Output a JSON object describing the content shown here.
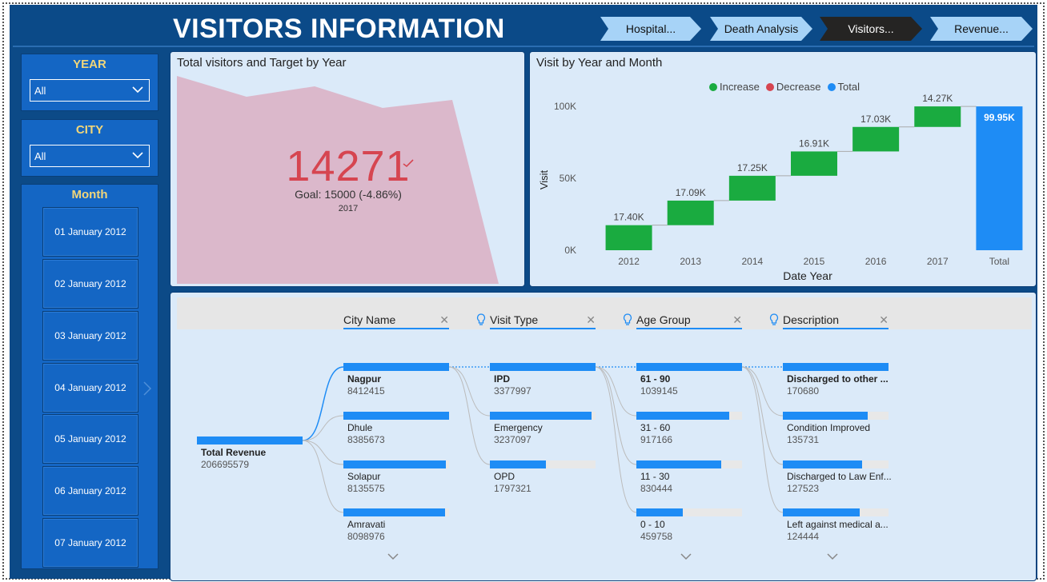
{
  "header": {
    "title": "VISITORS INFORMATION",
    "nav": [
      {
        "label": "Hospital...",
        "active": false
      },
      {
        "label": "Death Analysis",
        "active": false
      },
      {
        "label": "Visitors...",
        "active": true
      },
      {
        "label": "Revenue...",
        "active": false
      }
    ]
  },
  "sidebar": {
    "year": {
      "title": "YEAR",
      "value": "All"
    },
    "city": {
      "title": "CITY",
      "value": "All"
    },
    "month": {
      "title": "Month",
      "items": [
        "01 January 2012",
        "02 January 2012",
        "03 January 2012",
        "04 January 2012",
        "05 January 2012",
        "06 January 2012",
        "07 January 2012"
      ]
    }
  },
  "kpi": {
    "title": "Total visitors and Target by Year",
    "value": "14271",
    "goal": "Goal: 15000 (-4.86%)",
    "year": "2017"
  },
  "waterfall": {
    "title": "Visit by Year and Month",
    "legend": [
      {
        "label": "Increase",
        "color": "#1aab40"
      },
      {
        "label": "Decrease",
        "color": "#d64550"
      },
      {
        "label": "Total",
        "color": "#1e8cf5"
      }
    ]
  },
  "chart_data": {
    "type": "bar",
    "subtype": "waterfall",
    "categories": [
      "2012",
      "2013",
      "2014",
      "2015",
      "2016",
      "2017",
      "Total"
    ],
    "values": [
      17.4,
      17.09,
      17.25,
      16.91,
      17.03,
      14.27,
      99.95
    ],
    "data_labels": [
      "17.40K",
      "17.09K",
      "17.25K",
      "16.91K",
      "17.03K",
      "14.27K",
      "99.95K"
    ],
    "xlabel": "Date Year",
    "ylabel": "Visit",
    "yticks": [
      "0K",
      "50K",
      "100K"
    ],
    "ylim": [
      0,
      100
    ],
    "unit": "K"
  },
  "tree": {
    "columns": [
      "City Name",
      "Visit Type",
      "Age Group",
      "Description"
    ],
    "root": {
      "label": "Total Revenue",
      "value": "206695579"
    },
    "city": [
      {
        "label": "Nagpur",
        "value": "8412415",
        "fill": 1.0
      },
      {
        "label": "Dhule",
        "value": "8385673",
        "fill": 1.0
      },
      {
        "label": "Solapur",
        "value": "8135575",
        "fill": 0.97
      },
      {
        "label": "Amravati",
        "value": "8098976",
        "fill": 0.96
      }
    ],
    "visit_type": [
      {
        "label": "IPD",
        "value": "3377997",
        "fill": 1.0
      },
      {
        "label": "Emergency",
        "value": "3237097",
        "fill": 0.96
      },
      {
        "label": "OPD",
        "value": "1797321",
        "fill": 0.53
      }
    ],
    "age_group": [
      {
        "label": "61 - 90",
        "value": "1039145",
        "fill": 1.0
      },
      {
        "label": "31 - 60",
        "value": "917166",
        "fill": 0.88
      },
      {
        "label": "11 - 30",
        "value": "830444",
        "fill": 0.8
      },
      {
        "label": "0 - 10",
        "value": "459758",
        "fill": 0.44
      }
    ],
    "description": [
      {
        "label": "Discharged to other ...",
        "value": "170680",
        "fill": 1.0
      },
      {
        "label": "Condition Improved",
        "value": "135731",
        "fill": 0.8
      },
      {
        "label": "Discharged to Law Enf...",
        "value": "127523",
        "fill": 0.75
      },
      {
        "label": "Left against medical a...",
        "value": "124444",
        "fill": 0.73
      }
    ]
  }
}
